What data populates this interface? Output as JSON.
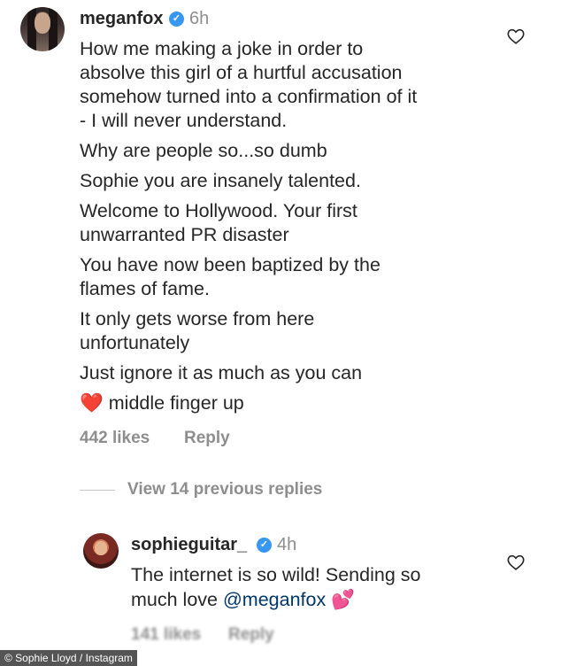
{
  "comment": {
    "username": "meganfox",
    "time": "6h",
    "lines": [
      "How me making a joke in order to",
      "absolve this girl of a hurtful accusation",
      "somehow turned into a confirmation of it",
      "- I will never understand.",
      "Why are people so...so dumb",
      "Sophie you are insanely talented.",
      "Welcome to Hollywood. Your first",
      "unwarranted PR disaster",
      "You have now been baptized by the",
      "flames of fame.",
      "It only gets worse from here",
      "unfortunately",
      "Just ignore it as much as you can",
      "middle finger up"
    ],
    "heart_emoji": "❤️",
    "likes": "442 likes",
    "reply_label": "Reply"
  },
  "view_replies": "View 14 previous replies",
  "reply": {
    "username": "sophieguitar_",
    "time": "4h",
    "line1": "The internet is so wild! Sending so",
    "line2_text": "much love ",
    "mention": "@meganfox",
    "emoji": "💕",
    "likes": "141 likes",
    "reply_label": "Reply"
  },
  "credit": "© Sophie Lloyd / Instagram",
  "icons": {
    "like": "heart-outline-icon",
    "verified": "verified-badge-icon"
  }
}
